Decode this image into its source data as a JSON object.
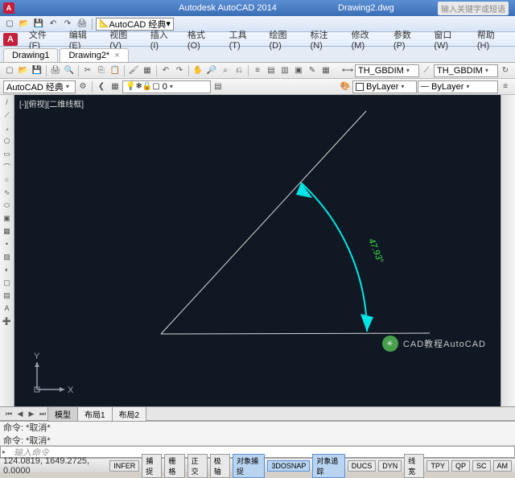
{
  "titlebar": {
    "app": "Autodesk AutoCAD 2014",
    "doc": "Drawing2.dwg",
    "search_ph": "输入关键字或短语"
  },
  "qat": {
    "workspace": "AutoCAD 经典"
  },
  "menu": {
    "items": [
      "文件(F)",
      "编辑(E)",
      "视图(V)",
      "插入(I)",
      "格式(O)",
      "工具(T)",
      "绘图(D)",
      "标注(N)",
      "修改(M)",
      "参数(P)",
      "窗口(W)",
      "帮助(H)"
    ]
  },
  "doctabs": {
    "tabs": [
      {
        "label": "Drawing1",
        "active": false
      },
      {
        "label": "Drawing2*",
        "active": true
      }
    ]
  },
  "props": {
    "workspace": "AutoCAD 经典",
    "layer": "0",
    "color": "ByLayer",
    "ltype": "ByLayer",
    "dimstyle1": "TH_GBDIM",
    "dimstyle2": "TH_GBDIM"
  },
  "viewport": {
    "label": "[-][俯视][二维线框]"
  },
  "dimension": {
    "value": "47.93°"
  },
  "ucs": {
    "x": "X",
    "y": "Y"
  },
  "modeltabs": {
    "tabs": [
      "模型",
      "布局1",
      "布局2"
    ]
  },
  "cmd": {
    "l1": "命令: *取消*",
    "l2": "命令: *取消*",
    "prompt": "输入命令",
    "chev": "▸"
  },
  "status": {
    "coords": "124.0819, 1649.2725, 0.0000",
    "buttons": [
      "INFER",
      "捕捉",
      "栅格",
      "正交",
      "极轴",
      "对象捕捉",
      "3DOSNAP",
      "对象追踪",
      "DUCS",
      "DYN",
      "线宽",
      "TPY",
      "QP",
      "SC",
      "AM"
    ],
    "on": [
      5,
      6,
      7
    ]
  },
  "watermark": {
    "text": "CAD教程AutoCAD"
  },
  "chart_data": {
    "type": "diagram",
    "description": "AutoCAD angle dimension between two lines",
    "lines": [
      {
        "from": [
          200,
          394
        ],
        "to": [
          455,
          117
        ]
      },
      {
        "from": [
          200,
          394
        ],
        "to": [
          534,
          393
        ]
      }
    ],
    "dimension_arc": {
      "center": [
        200,
        394
      ],
      "radius": 240,
      "start_deg": -47,
      "end_deg": 2,
      "color": "#00e5e5"
    },
    "angle_value": 47.93,
    "angle_label": "47.93°",
    "label_color": "#3de24a"
  }
}
